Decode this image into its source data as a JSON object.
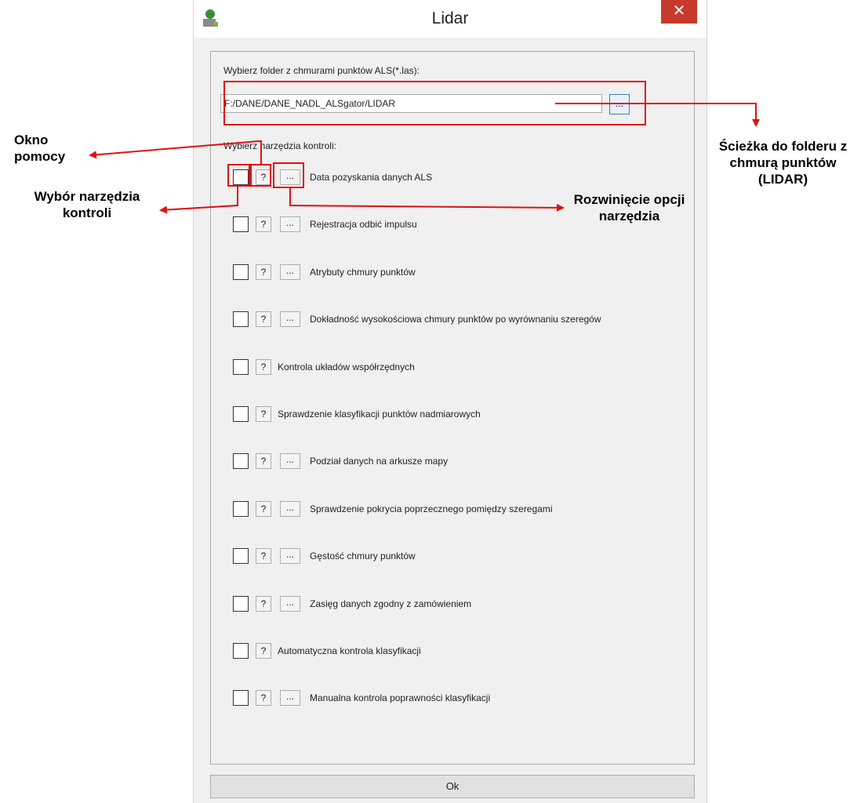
{
  "window": {
    "title": "Lidar",
    "close_symbol": "✕"
  },
  "folder": {
    "label": "Wybierz folder z chmurami punktów ALS(*.las):",
    "path_value": "F:/DANE/DANE_NADL_ALSgator/LIDAR",
    "browse_label": "..."
  },
  "tools": {
    "label": "Wybierz narzędzia kontroli:",
    "help_label": "?",
    "options_label": "...",
    "items": [
      {
        "label": "Data pozyskania danych ALS",
        "has_options": true
      },
      {
        "label": "Rejestracja odbić impulsu",
        "has_options": true
      },
      {
        "label": "Atrybuty chmury punktów",
        "has_options": true
      },
      {
        "label": "Dokładność wysokościowa chmury punktów po wyrównaniu szeregów",
        "has_options": true
      },
      {
        "label": "Kontrola układów współrzędnych",
        "has_options": false
      },
      {
        "label": "Sprawdzenie klasyfikacji punktów nadmiarowych",
        "has_options": false
      },
      {
        "label": "Podział danych na arkusze mapy",
        "has_options": true
      },
      {
        "label": "Sprawdzenie pokrycia poprzecznego pomiędzy szeregami",
        "has_options": true
      },
      {
        "label": "Gęstość chmury punktów",
        "has_options": true
      },
      {
        "label": "Zasięg danych zgodny z zamówieniem",
        "has_options": true
      },
      {
        "label": "Automatyczna kontrola klasyfikacji",
        "has_options": false
      },
      {
        "label": "Manualna kontrola poprawności klasyfikacji",
        "has_options": true
      }
    ]
  },
  "ok_label": "Ok",
  "annotations": {
    "help_window": "Okno pomocy",
    "tool_select": "Wybór narzędzia kontroli",
    "expand_options": "Rozwinięcie opcji narzędzia",
    "folder_path": "Ścieżka do folderu z chmurą punktów (LIDAR)"
  },
  "colors": {
    "annotation": "#e01010",
    "close": "#c7392c",
    "browse_border": "#3c7fb1"
  }
}
